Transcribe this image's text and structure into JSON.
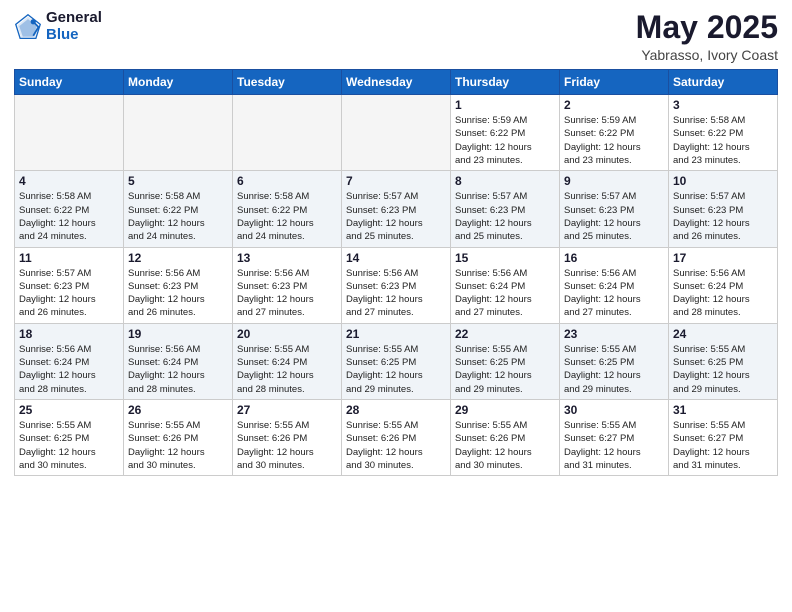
{
  "logo": {
    "general": "General",
    "blue": "Blue"
  },
  "title": {
    "month": "May 2025",
    "location": "Yabrasso, Ivory Coast"
  },
  "weekdays": [
    "Sunday",
    "Monday",
    "Tuesday",
    "Wednesday",
    "Thursday",
    "Friday",
    "Saturday"
  ],
  "weeks": [
    [
      {
        "day": "",
        "info": ""
      },
      {
        "day": "",
        "info": ""
      },
      {
        "day": "",
        "info": ""
      },
      {
        "day": "",
        "info": ""
      },
      {
        "day": "1",
        "info": "Sunrise: 5:59 AM\nSunset: 6:22 PM\nDaylight: 12 hours\nand 23 minutes."
      },
      {
        "day": "2",
        "info": "Sunrise: 5:59 AM\nSunset: 6:22 PM\nDaylight: 12 hours\nand 23 minutes."
      },
      {
        "day": "3",
        "info": "Sunrise: 5:58 AM\nSunset: 6:22 PM\nDaylight: 12 hours\nand 23 minutes."
      }
    ],
    [
      {
        "day": "4",
        "info": "Sunrise: 5:58 AM\nSunset: 6:22 PM\nDaylight: 12 hours\nand 24 minutes."
      },
      {
        "day": "5",
        "info": "Sunrise: 5:58 AM\nSunset: 6:22 PM\nDaylight: 12 hours\nand 24 minutes."
      },
      {
        "day": "6",
        "info": "Sunrise: 5:58 AM\nSunset: 6:22 PM\nDaylight: 12 hours\nand 24 minutes."
      },
      {
        "day": "7",
        "info": "Sunrise: 5:57 AM\nSunset: 6:23 PM\nDaylight: 12 hours\nand 25 minutes."
      },
      {
        "day": "8",
        "info": "Sunrise: 5:57 AM\nSunset: 6:23 PM\nDaylight: 12 hours\nand 25 minutes."
      },
      {
        "day": "9",
        "info": "Sunrise: 5:57 AM\nSunset: 6:23 PM\nDaylight: 12 hours\nand 25 minutes."
      },
      {
        "day": "10",
        "info": "Sunrise: 5:57 AM\nSunset: 6:23 PM\nDaylight: 12 hours\nand 26 minutes."
      }
    ],
    [
      {
        "day": "11",
        "info": "Sunrise: 5:57 AM\nSunset: 6:23 PM\nDaylight: 12 hours\nand 26 minutes."
      },
      {
        "day": "12",
        "info": "Sunrise: 5:56 AM\nSunset: 6:23 PM\nDaylight: 12 hours\nand 26 minutes."
      },
      {
        "day": "13",
        "info": "Sunrise: 5:56 AM\nSunset: 6:23 PM\nDaylight: 12 hours\nand 27 minutes."
      },
      {
        "day": "14",
        "info": "Sunrise: 5:56 AM\nSunset: 6:23 PM\nDaylight: 12 hours\nand 27 minutes."
      },
      {
        "day": "15",
        "info": "Sunrise: 5:56 AM\nSunset: 6:24 PM\nDaylight: 12 hours\nand 27 minutes."
      },
      {
        "day": "16",
        "info": "Sunrise: 5:56 AM\nSunset: 6:24 PM\nDaylight: 12 hours\nand 27 minutes."
      },
      {
        "day": "17",
        "info": "Sunrise: 5:56 AM\nSunset: 6:24 PM\nDaylight: 12 hours\nand 28 minutes."
      }
    ],
    [
      {
        "day": "18",
        "info": "Sunrise: 5:56 AM\nSunset: 6:24 PM\nDaylight: 12 hours\nand 28 minutes."
      },
      {
        "day": "19",
        "info": "Sunrise: 5:56 AM\nSunset: 6:24 PM\nDaylight: 12 hours\nand 28 minutes."
      },
      {
        "day": "20",
        "info": "Sunrise: 5:55 AM\nSunset: 6:24 PM\nDaylight: 12 hours\nand 28 minutes."
      },
      {
        "day": "21",
        "info": "Sunrise: 5:55 AM\nSunset: 6:25 PM\nDaylight: 12 hours\nand 29 minutes."
      },
      {
        "day": "22",
        "info": "Sunrise: 5:55 AM\nSunset: 6:25 PM\nDaylight: 12 hours\nand 29 minutes."
      },
      {
        "day": "23",
        "info": "Sunrise: 5:55 AM\nSunset: 6:25 PM\nDaylight: 12 hours\nand 29 minutes."
      },
      {
        "day": "24",
        "info": "Sunrise: 5:55 AM\nSunset: 6:25 PM\nDaylight: 12 hours\nand 29 minutes."
      }
    ],
    [
      {
        "day": "25",
        "info": "Sunrise: 5:55 AM\nSunset: 6:25 PM\nDaylight: 12 hours\nand 30 minutes."
      },
      {
        "day": "26",
        "info": "Sunrise: 5:55 AM\nSunset: 6:26 PM\nDaylight: 12 hours\nand 30 minutes."
      },
      {
        "day": "27",
        "info": "Sunrise: 5:55 AM\nSunset: 6:26 PM\nDaylight: 12 hours\nand 30 minutes."
      },
      {
        "day": "28",
        "info": "Sunrise: 5:55 AM\nSunset: 6:26 PM\nDaylight: 12 hours\nand 30 minutes."
      },
      {
        "day": "29",
        "info": "Sunrise: 5:55 AM\nSunset: 6:26 PM\nDaylight: 12 hours\nand 30 minutes."
      },
      {
        "day": "30",
        "info": "Sunrise: 5:55 AM\nSunset: 6:27 PM\nDaylight: 12 hours\nand 31 minutes."
      },
      {
        "day": "31",
        "info": "Sunrise: 5:55 AM\nSunset: 6:27 PM\nDaylight: 12 hours\nand 31 minutes."
      }
    ]
  ]
}
